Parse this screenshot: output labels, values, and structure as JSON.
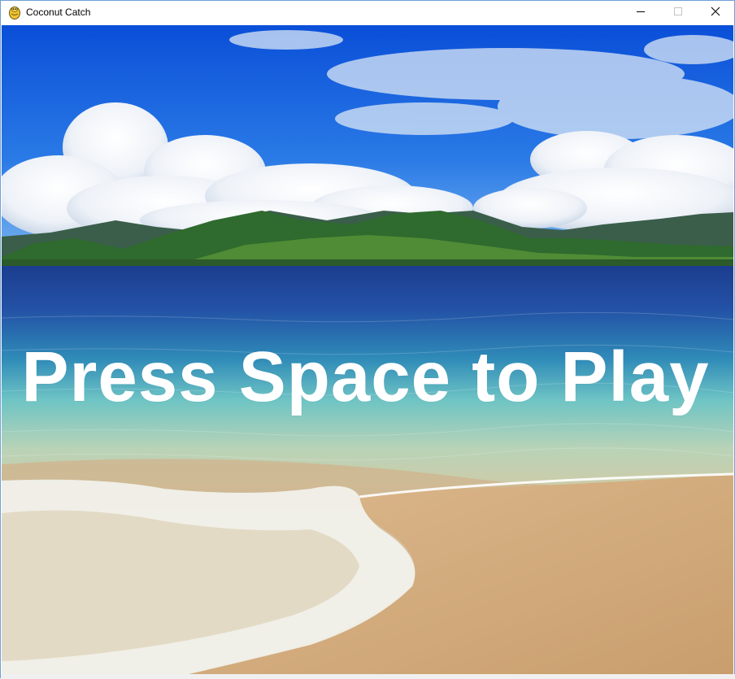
{
  "window": {
    "title": "Coconut Catch",
    "icon": "python-snake-icon",
    "controls": {
      "minimize": "minimize-icon",
      "maximize": "maximize-icon",
      "close": "close-icon"
    }
  },
  "game": {
    "prompt": "Press Space to Play",
    "prompt_color": "#ffffff",
    "background": "tropical-beach-scene"
  }
}
